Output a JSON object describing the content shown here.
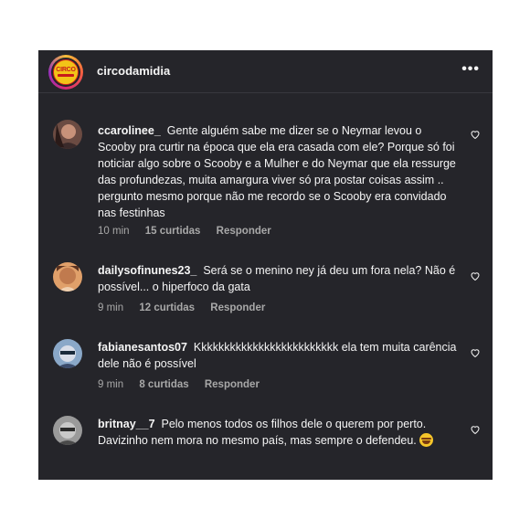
{
  "post": {
    "username": "circodamidia",
    "logo_text": "CIRCO",
    "more_icon": "more-options-icon"
  },
  "comments": [
    {
      "username": "ccarolinee_",
      "text": "Gente alguém sabe me dizer se o Neymar levou o Scooby pra curtir na época que ela era casada com ele? Porque só foi noticiar algo sobre o Scooby e a Mulher e do Neymar que ela ressurge das profundezas, muita amargura viver só pra postar coisas assim .. pergunto mesmo porque não me recordo se o Scooby era convidado nas festinhas",
      "time": "10 min",
      "likes": "15 curtidas",
      "reply": "Responder"
    },
    {
      "username": "dailysofinunes23_",
      "text": "Será se o menino ney já deu um fora nela? Não é possível... o hiperfoco da gata",
      "time": "9 min",
      "likes": "12 curtidas",
      "reply": "Responder"
    },
    {
      "username": "fabianesantos07",
      "text": "Kkkkkkkkkkkkkkkkkkkkkkkkk ela tem muita carência dele não é possível",
      "time": "9 min",
      "likes": "8 curtidas",
      "reply": "Responder"
    },
    {
      "username": "britnay__7",
      "text": "Pelo menos todos os filhos dele o querem por perto. Davizinho nem mora no mesmo país, mas sempre o defendeu.",
      "emoji": "laughing-emoji",
      "time": "",
      "likes": "",
      "reply": ""
    }
  ],
  "colors": {
    "background": "#25252a",
    "text": "#f5f5f5",
    "meta": "#a8a8a8"
  }
}
